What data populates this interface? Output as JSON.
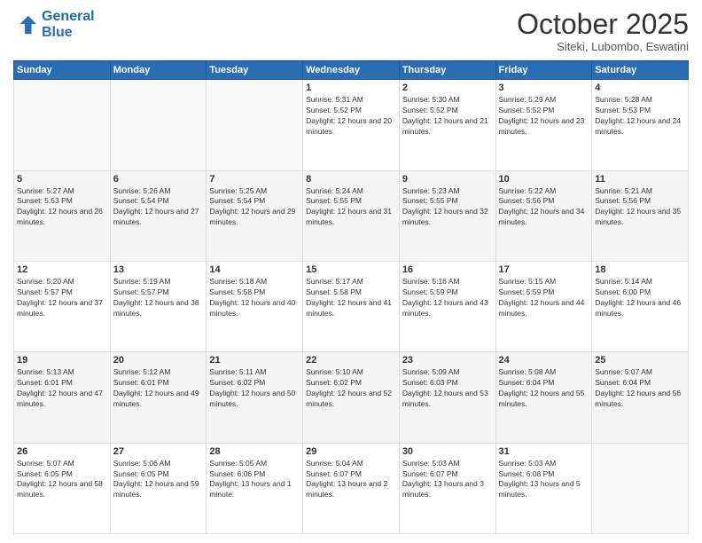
{
  "logo": {
    "line1": "General",
    "line2": "Blue"
  },
  "header": {
    "month": "October 2025",
    "location": "Siteki, Lubombo, Eswatini"
  },
  "weekdays": [
    "Sunday",
    "Monday",
    "Tuesday",
    "Wednesday",
    "Thursday",
    "Friday",
    "Saturday"
  ],
  "weeks": [
    [
      {
        "day": "",
        "empty": true
      },
      {
        "day": "",
        "empty": true
      },
      {
        "day": "",
        "empty": true
      },
      {
        "day": "1",
        "sunrise": "5:31 AM",
        "sunset": "5:52 PM",
        "daylight": "12 hours and 20 minutes."
      },
      {
        "day": "2",
        "sunrise": "5:30 AM",
        "sunset": "5:52 PM",
        "daylight": "12 hours and 21 minutes."
      },
      {
        "day": "3",
        "sunrise": "5:29 AM",
        "sunset": "5:52 PM",
        "daylight": "12 hours and 23 minutes."
      },
      {
        "day": "4",
        "sunrise": "5:28 AM",
        "sunset": "5:53 PM",
        "daylight": "12 hours and 24 minutes."
      }
    ],
    [
      {
        "day": "5",
        "sunrise": "5:27 AM",
        "sunset": "5:53 PM",
        "daylight": "12 hours and 26 minutes."
      },
      {
        "day": "6",
        "sunrise": "5:26 AM",
        "sunset": "5:54 PM",
        "daylight": "12 hours and 27 minutes."
      },
      {
        "day": "7",
        "sunrise": "5:25 AM",
        "sunset": "5:54 PM",
        "daylight": "12 hours and 29 minutes."
      },
      {
        "day": "8",
        "sunrise": "5:24 AM",
        "sunset": "5:55 PM",
        "daylight": "12 hours and 31 minutes."
      },
      {
        "day": "9",
        "sunrise": "5:23 AM",
        "sunset": "5:55 PM",
        "daylight": "12 hours and 32 minutes."
      },
      {
        "day": "10",
        "sunrise": "5:22 AM",
        "sunset": "5:56 PM",
        "daylight": "12 hours and 34 minutes."
      },
      {
        "day": "11",
        "sunrise": "5:21 AM",
        "sunset": "5:56 PM",
        "daylight": "12 hours and 35 minutes."
      }
    ],
    [
      {
        "day": "12",
        "sunrise": "5:20 AM",
        "sunset": "5:57 PM",
        "daylight": "12 hours and 37 minutes."
      },
      {
        "day": "13",
        "sunrise": "5:19 AM",
        "sunset": "5:57 PM",
        "daylight": "12 hours and 38 minutes."
      },
      {
        "day": "14",
        "sunrise": "5:18 AM",
        "sunset": "5:58 PM",
        "daylight": "12 hours and 40 minutes."
      },
      {
        "day": "15",
        "sunrise": "5:17 AM",
        "sunset": "5:58 PM",
        "daylight": "12 hours and 41 minutes."
      },
      {
        "day": "16",
        "sunrise": "5:16 AM",
        "sunset": "5:59 PM",
        "daylight": "12 hours and 43 minutes."
      },
      {
        "day": "17",
        "sunrise": "5:15 AM",
        "sunset": "5:59 PM",
        "daylight": "12 hours and 44 minutes."
      },
      {
        "day": "18",
        "sunrise": "5:14 AM",
        "sunset": "6:00 PM",
        "daylight": "12 hours and 46 minutes."
      }
    ],
    [
      {
        "day": "19",
        "sunrise": "5:13 AM",
        "sunset": "6:01 PM",
        "daylight": "12 hours and 47 minutes."
      },
      {
        "day": "20",
        "sunrise": "5:12 AM",
        "sunset": "6:01 PM",
        "daylight": "12 hours and 49 minutes."
      },
      {
        "day": "21",
        "sunrise": "5:11 AM",
        "sunset": "6:02 PM",
        "daylight": "12 hours and 50 minutes."
      },
      {
        "day": "22",
        "sunrise": "5:10 AM",
        "sunset": "6:02 PM",
        "daylight": "12 hours and 52 minutes."
      },
      {
        "day": "23",
        "sunrise": "5:09 AM",
        "sunset": "6:03 PM",
        "daylight": "12 hours and 53 minutes."
      },
      {
        "day": "24",
        "sunrise": "5:08 AM",
        "sunset": "6:04 PM",
        "daylight": "12 hours and 55 minutes."
      },
      {
        "day": "25",
        "sunrise": "5:07 AM",
        "sunset": "6:04 PM",
        "daylight": "12 hours and 56 minutes."
      }
    ],
    [
      {
        "day": "26",
        "sunrise": "5:07 AM",
        "sunset": "6:05 PM",
        "daylight": "12 hours and 58 minutes."
      },
      {
        "day": "27",
        "sunrise": "5:06 AM",
        "sunset": "6:05 PM",
        "daylight": "12 hours and 59 minutes."
      },
      {
        "day": "28",
        "sunrise": "5:05 AM",
        "sunset": "6:06 PM",
        "daylight": "13 hours and 1 minute."
      },
      {
        "day": "29",
        "sunrise": "5:04 AM",
        "sunset": "6:07 PM",
        "daylight": "13 hours and 2 minutes."
      },
      {
        "day": "30",
        "sunrise": "5:03 AM",
        "sunset": "6:07 PM",
        "daylight": "13 hours and 3 minutes."
      },
      {
        "day": "31",
        "sunrise": "5:03 AM",
        "sunset": "6:08 PM",
        "daylight": "13 hours and 5 minutes."
      },
      {
        "day": "",
        "empty": true
      }
    ]
  ]
}
